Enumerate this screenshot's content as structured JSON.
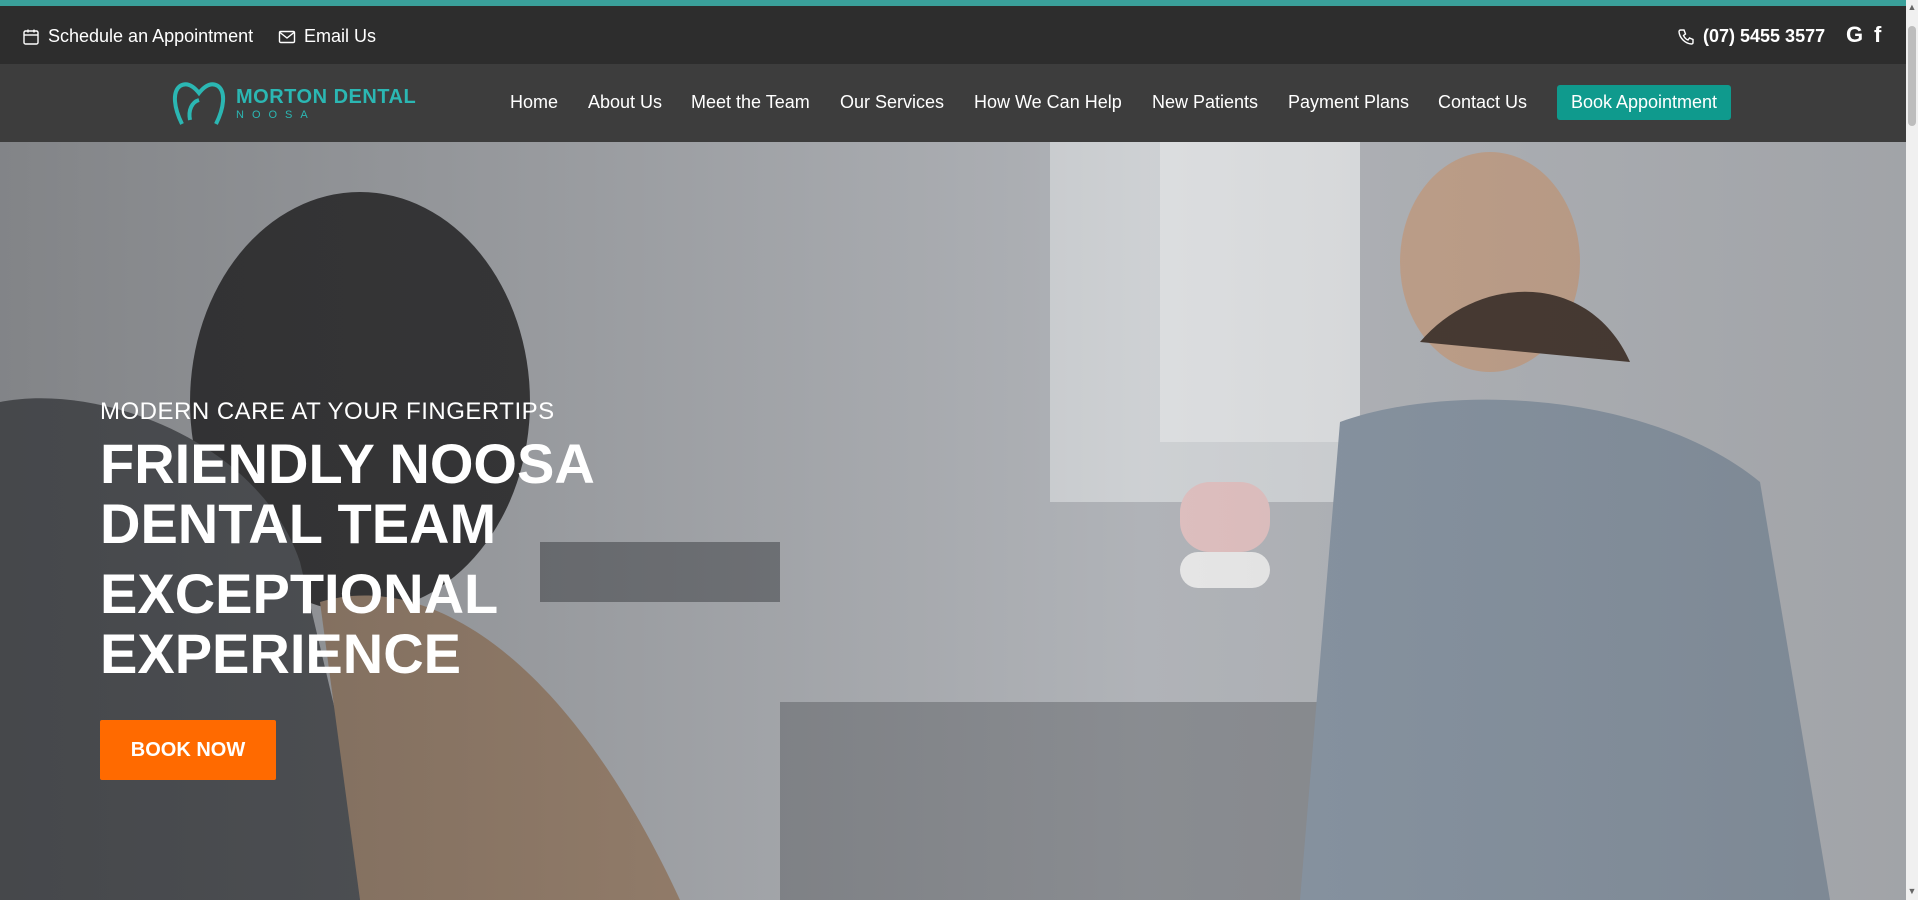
{
  "topbar": {
    "schedule_label": "Schedule an Appointment",
    "email_label": "Email Us",
    "phone": "(07) 5455 3577",
    "social": [
      "G",
      "f"
    ]
  },
  "logo": {
    "main": "MORTON DENTAL",
    "sub": "NOOSA"
  },
  "nav": {
    "items": [
      "Home",
      "About Us",
      "Meet the Team",
      "Our Services",
      "How We Can Help",
      "New Patients",
      "Payment Plans",
      "Contact Us"
    ],
    "cta": "Book Appointment"
  },
  "hero": {
    "kicker": "MODERN CARE AT YOUR FINGERTIPS",
    "headline": "FRIENDLY NOOSA DENTAL TEAM",
    "subheadline": "EXCEPTIONAL EXPERIENCE",
    "button": "BOOK NOW"
  },
  "colors": {
    "accent": "#2bb7b3",
    "cta_teal": "#0f9a8d",
    "cta_orange": "#ff6a00"
  },
  "icons": [
    "calendar-icon",
    "mail-icon",
    "phone-icon",
    "google-icon",
    "facebook-icon",
    "logo-tooth-icon"
  ]
}
